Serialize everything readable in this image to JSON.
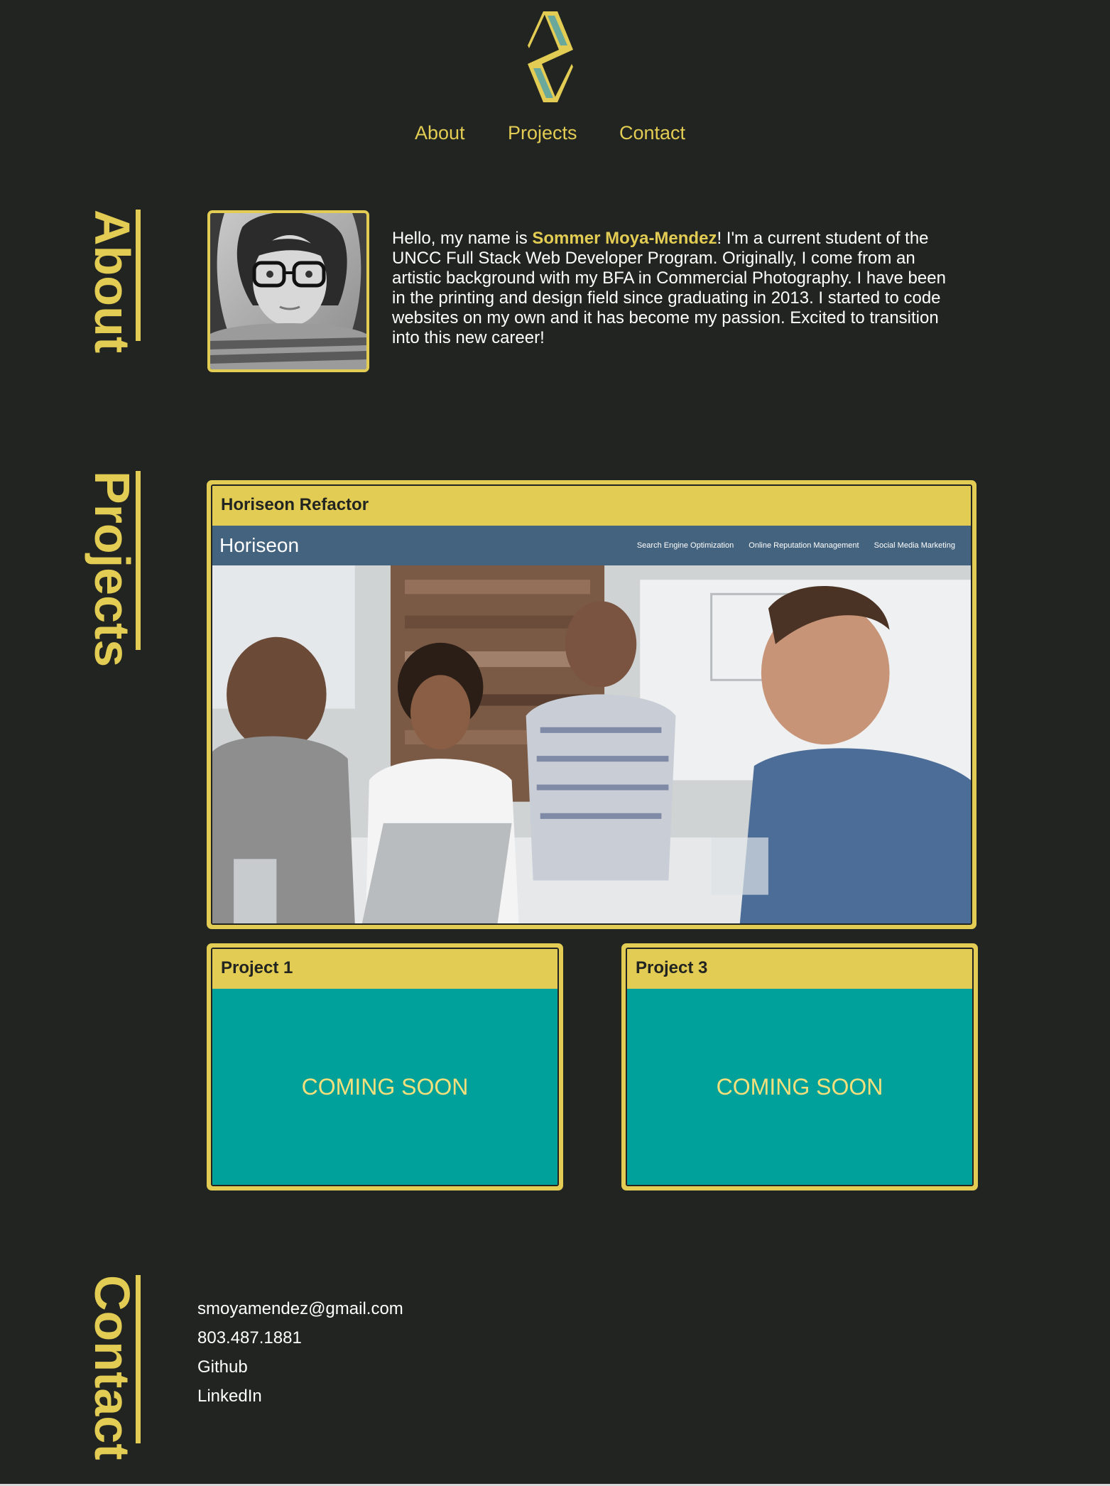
{
  "header": {
    "logo_icon": "s-diamond-logo-icon",
    "nav": {
      "about": "About",
      "projects": "Projects",
      "contact": "Contact"
    }
  },
  "sections": {
    "about_title": "About",
    "projects_title": "Projects",
    "contact_title": "Contact"
  },
  "about": {
    "intro": "Hello, my name is ",
    "name": "Sommer Moya-Mendez",
    "body": "! I'm a current student of the UNCC Full Stack Web Developer Program. Originally, I come from an artistic background with my BFA in Commercial Photography. I have been in the printing and design field since graduating in 2013. I started to code websites on my own and it has become my passion. Excited to transition into this new career!"
  },
  "projects": {
    "featured": {
      "title": "Horiseon Refactor",
      "preview": {
        "logo": "Horiseon",
        "links": [
          "Search Engine Optimization",
          "Online Reputation Management",
          "Social Media Marketing"
        ]
      }
    },
    "items": [
      {
        "title": "Project 1",
        "status": "COMING SOON"
      },
      {
        "title": "Project 3",
        "status": "COMING SOON"
      }
    ]
  },
  "contact": {
    "email": "smoyamendez@gmail.com",
    "phone": "803.487.1881",
    "github": "Github",
    "linkedin": "LinkedIn"
  },
  "colors": {
    "background": "#212421",
    "accent": "#e3cc53",
    "teal": "#00a19a",
    "text": "#ffffff"
  }
}
